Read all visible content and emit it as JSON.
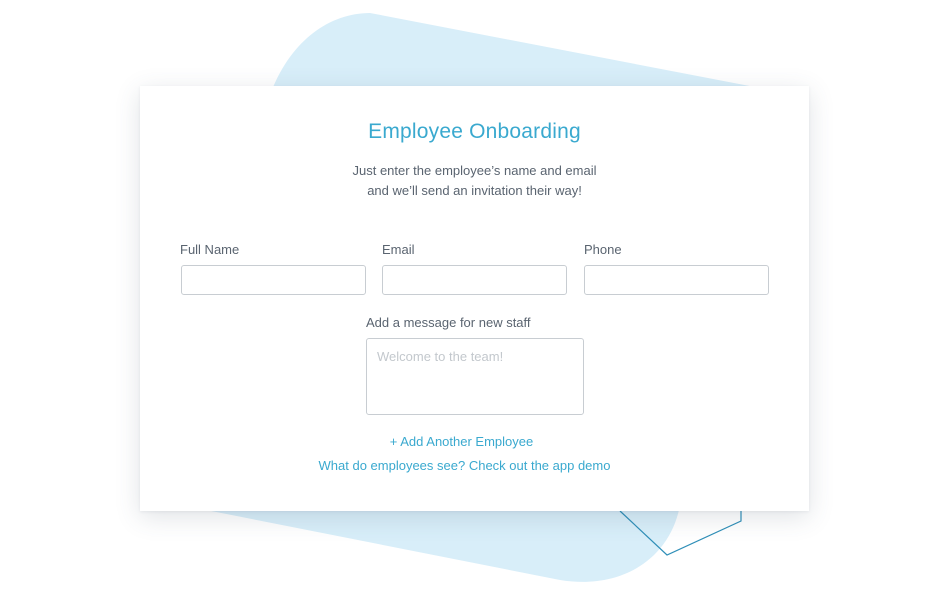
{
  "form": {
    "title": "Employee Onboarding",
    "subtitle_line1": "Just enter the employee’s name and email",
    "subtitle_line2": "and we’ll send an invitation their way!",
    "fields": {
      "full_name": {
        "label": "Full Name",
        "value": ""
      },
      "email": {
        "label": "Email",
        "value": ""
      },
      "phone": {
        "label": "Phone",
        "value": ""
      }
    },
    "message": {
      "label": "Add a message for new staff",
      "placeholder": "Welcome to the team!"
    },
    "add_employee_link": "+ Add Another Employee",
    "demo_link": "What do employees see? Check out the app demo"
  },
  "colors": {
    "accent": "#3aa9cf",
    "background_shape": "#d8eef9",
    "outline_shape": "#2f8fb8",
    "label_text": "#5a6470",
    "input_border": "#c8cdd2"
  }
}
